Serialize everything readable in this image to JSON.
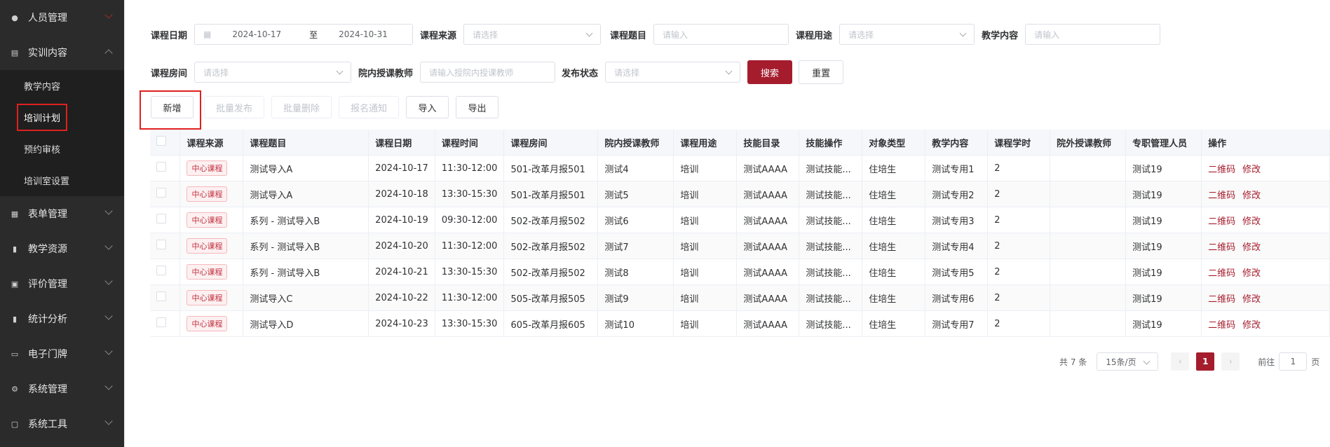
{
  "sidebar": {
    "items": [
      {
        "label": "人员管理",
        "icon": "user-icon"
      },
      {
        "label": "实训内容",
        "icon": "book-icon"
      },
      {
        "label": "表单管理",
        "icon": "form-icon"
      },
      {
        "label": "教学资源",
        "icon": "resource-icon"
      },
      {
        "label": "评价管理",
        "icon": "evaluate-icon"
      },
      {
        "label": "统计分析",
        "icon": "chart-icon"
      },
      {
        "label": "电子门牌",
        "icon": "monitor-icon"
      },
      {
        "label": "系统管理",
        "icon": "gear-icon"
      },
      {
        "label": "系统工具",
        "icon": "toolbox-icon"
      }
    ],
    "submenu": [
      "教学内容",
      "培训计划",
      "预约审核",
      "培训室设置"
    ]
  },
  "filters": {
    "date_label": "课程日期",
    "date_start": "2024-10-17",
    "date_sep": "至",
    "date_end": "2024-10-31",
    "source_label": "课程来源",
    "source_placeholder": "请选择",
    "topic_label": "课程题目",
    "topic_placeholder": "请输入",
    "purpose_label": "课程用途",
    "purpose_placeholder": "请选择",
    "content_label": "教学内容",
    "content_placeholder": "请输入",
    "room_label": "课程房间",
    "room_placeholder": "请选择",
    "teacher_label": "院内授课教师",
    "teacher_placeholder": "请输入授院内授课教师",
    "status_label": "发布状态",
    "status_placeholder": "请选择",
    "search": "搜索",
    "reset": "重置"
  },
  "toolbar": {
    "add": "新增",
    "batch_publish": "批量发布",
    "batch_delete": "批量删除",
    "notify": "报名通知",
    "import": "导入",
    "export": "导出"
  },
  "table": {
    "headers": [
      "课程来源",
      "课程题目",
      "课程日期",
      "课程时间",
      "课程房间",
      "院内授课教师",
      "课程用途",
      "技能目录",
      "技能操作",
      "对象类型",
      "教学内容",
      "课程学时",
      "院外授课教师",
      "专职管理人员",
      "操作"
    ],
    "rows": [
      {
        "source": "中心课程",
        "title": "测试导入A",
        "date": "2024-10-17",
        "time": "11:30-12:00",
        "room": "501-改革月报501",
        "teacher": "测试4",
        "purpose": "培训",
        "skill_dir": "测试AAAA",
        "skill_op": "测试技能...",
        "target": "住培生",
        "content": "测试专用1",
        "hours": "2",
        "ext_teacher": "",
        "manager": "测试19",
        "op1": "二维码",
        "op2": "修改"
      },
      {
        "source": "中心课程",
        "title": "测试导入A",
        "date": "2024-10-18",
        "time": "13:30-15:30",
        "room": "501-改革月报501",
        "teacher": "测试5",
        "purpose": "培训",
        "skill_dir": "测试AAAA",
        "skill_op": "测试技能...",
        "target": "住培生",
        "content": "测试专用2",
        "hours": "2",
        "ext_teacher": "",
        "manager": "测试19",
        "op1": "二维码",
        "op2": "修改"
      },
      {
        "source": "中心课程",
        "title": "系列 - 测试导入B",
        "date": "2024-10-19",
        "time": "09:30-12:00",
        "room": "502-改革月报502",
        "teacher": "测试6",
        "purpose": "培训",
        "skill_dir": "测试AAAA",
        "skill_op": "测试技能...",
        "target": "住培生",
        "content": "测试专用3",
        "hours": "2",
        "ext_teacher": "",
        "manager": "测试19",
        "op1": "二维码",
        "op2": "修改"
      },
      {
        "source": "中心课程",
        "title": "系列 - 测试导入B",
        "date": "2024-10-20",
        "time": "11:30-12:00",
        "room": "502-改革月报502",
        "teacher": "测试7",
        "purpose": "培训",
        "skill_dir": "测试AAAA",
        "skill_op": "测试技能...",
        "target": "住培生",
        "content": "测试专用4",
        "hours": "2",
        "ext_teacher": "",
        "manager": "测试19",
        "op1": "二维码",
        "op2": "修改"
      },
      {
        "source": "中心课程",
        "title": "系列 - 测试导入B",
        "date": "2024-10-21",
        "time": "13:30-15:30",
        "room": "502-改革月报502",
        "teacher": "测试8",
        "purpose": "培训",
        "skill_dir": "测试AAAA",
        "skill_op": "测试技能...",
        "target": "住培生",
        "content": "测试专用5",
        "hours": "2",
        "ext_teacher": "",
        "manager": "测试19",
        "op1": "二维码",
        "op2": "修改"
      },
      {
        "source": "中心课程",
        "title": "测试导入C",
        "date": "2024-10-22",
        "time": "11:30-12:00",
        "room": "505-改革月报505",
        "teacher": "测试9",
        "purpose": "培训",
        "skill_dir": "测试AAAA",
        "skill_op": "测试技能...",
        "target": "住培生",
        "content": "测试专用6",
        "hours": "2",
        "ext_teacher": "",
        "manager": "测试19",
        "op1": "二维码",
        "op2": "修改"
      },
      {
        "source": "中心课程",
        "title": "测试导入D",
        "date": "2024-10-23",
        "time": "13:30-15:30",
        "room": "605-改革月报605",
        "teacher": "测试10",
        "purpose": "培训",
        "skill_dir": "测试AAAA",
        "skill_op": "测试技能...",
        "target": "住培生",
        "content": "测试专用7",
        "hours": "2",
        "ext_teacher": "",
        "manager": "测试19",
        "op1": "二维码",
        "op2": "修改"
      }
    ]
  },
  "pagination": {
    "total": "共 7 条",
    "page_size": "15条/页",
    "current": "1",
    "goto": "前往",
    "goto_value": "1",
    "page_unit": "页"
  },
  "colors": {
    "accent": "#a51d2d",
    "highlight_box": "#e0201f"
  }
}
